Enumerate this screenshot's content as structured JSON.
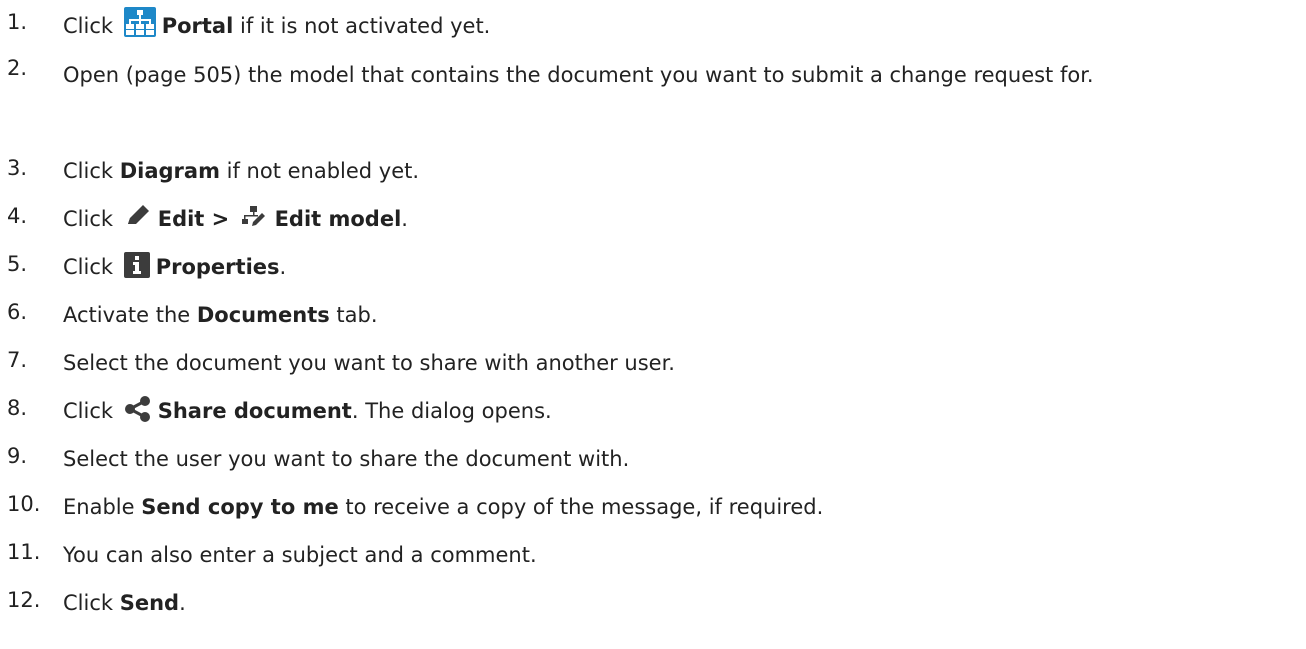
{
  "steps": [
    {
      "num": "1.",
      "pre": "Click ",
      "bold": "Portal",
      "post": " if it is not activated yet.",
      "icon": "portal-icon"
    },
    {
      "num": "2.",
      "pre": "Open ",
      "link": "(page 505)",
      "post": " the model that contains the document you want to submit a change request for."
    },
    {
      "num": "3.",
      "pre": "Click ",
      "bold": "Diagram",
      "post": " if not enabled yet."
    },
    {
      "num": "4.",
      "pre": "Click ",
      "bold": "Edit > ",
      "bold2": "Edit model",
      "post": ".",
      "icon": "pencil-icon",
      "icon2": "edit-model-icon"
    },
    {
      "num": "5.",
      "pre": "Click ",
      "bold": "Properties",
      "post": ".",
      "icon": "info-icon"
    },
    {
      "num": "6.",
      "pre": "Activate the ",
      "bold": "Documents",
      "post": " tab."
    },
    {
      "num": "7.",
      "text": "Select the document you want to share with another user."
    },
    {
      "num": "8.",
      "pre": "Click ",
      "bold": "Share document",
      "post": ". The dialog opens.",
      "icon": "share-icon"
    },
    {
      "num": "9.",
      "text": "Select the user you want to share the document with."
    },
    {
      "num": "10.",
      "pre": "Enable ",
      "bold": "Send copy to me",
      "post": " to receive a copy of the message, if required."
    },
    {
      "num": "11.",
      "text": "You can also enter a subject and a comment."
    },
    {
      "num": "12.",
      "pre": "Click ",
      "bold": "Send",
      "post": "."
    }
  ],
  "colors": {
    "portal_blue": "#1e88c8",
    "icon_dark": "#3c3c3c",
    "text": "#222222"
  }
}
